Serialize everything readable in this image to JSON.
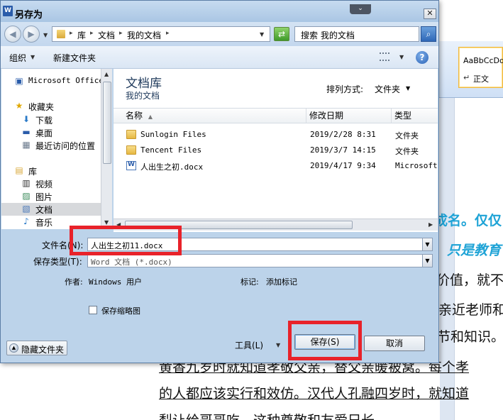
{
  "dialog": {
    "title": "另存为",
    "close_glyph": "✕",
    "collapse_glyph": "⌄"
  },
  "nav": {
    "breadcrumb": [
      "库",
      "文档",
      "我的文档"
    ],
    "search_placeholder": "搜索 我的文档"
  },
  "toolbar": {
    "organize": "组织",
    "new_folder": "新建文件夹"
  },
  "sidebar": {
    "items": [
      {
        "label": "Microsoft Office",
        "icon": "office-icon",
        "mono": true
      },
      {
        "label": "收藏夹",
        "icon": "star-icon"
      },
      {
        "label": "下载",
        "icon": "download-icon"
      },
      {
        "label": "桌面",
        "icon": "desktop-icon"
      },
      {
        "label": "最近访问的位置",
        "icon": "recent-icon"
      },
      {
        "label": "库",
        "icon": "library-icon"
      },
      {
        "label": "视频",
        "icon": "video-icon"
      },
      {
        "label": "图片",
        "icon": "picture-icon"
      },
      {
        "label": "文档",
        "icon": "document-icon",
        "selected": true
      },
      {
        "label": "音乐",
        "icon": "music-icon"
      }
    ]
  },
  "filepane": {
    "title": "文档库",
    "subtitle": "我的文档",
    "arrange_label": "排列方式:",
    "arrange_value": "文件夹",
    "columns": {
      "name": "名称",
      "date": "修改日期",
      "type": "类型"
    },
    "rows": [
      {
        "name": "Sunlogin Files",
        "date": "2019/2/28 8:31",
        "type": "文件夹",
        "kind": "folder"
      },
      {
        "name": "Tencent Files",
        "date": "2019/3/7 14:15",
        "type": "文件夹",
        "kind": "folder"
      },
      {
        "name": "人出生之初.docx",
        "date": "2019/4/17 9:34",
        "type": "Microsoft",
        "kind": "docx"
      }
    ]
  },
  "form": {
    "filename_label": "文件名(N):",
    "filename_value": "人出生之初11.docx",
    "filetype_label": "保存类型(T):",
    "filetype_value": "Word 文档 (*.docx)",
    "author_label": "作者:",
    "author_value": "Windows 用户",
    "tags_label": "标记:",
    "tags_value": "添加标记",
    "thumbnail_label": "保存缩略图"
  },
  "buttons": {
    "hide_folders": "隐藏文件夹",
    "tools": "工具(L)",
    "save": "保存(S)",
    "cancel": "取消"
  },
  "word": {
    "style_sample": "AaBbCcDd",
    "style_name": "正文",
    "lines": [
      "成名。仅仅",
      "只是教育",
      "价值，就不",
      "亲近老师和",
      "节和知识。",
      "黄香九岁时就知道孝敬父亲，替父亲暖被窝。每个孝",
      "的人都应该实行和效仿。汉代人孔融四岁时，就知道",
      "梨让给哥哥吃，这种尊敬和友爱兄长"
    ]
  },
  "colors": {
    "dialog_bg": "#bcd3ea",
    "highlight_red": "#e8222a",
    "doc_teal": "#1ea3d6"
  }
}
